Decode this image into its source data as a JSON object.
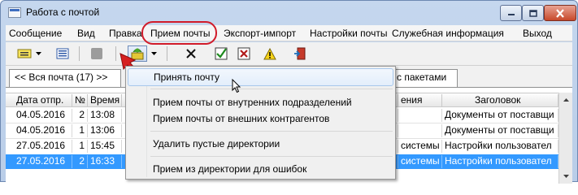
{
  "window": {
    "title": "Работа с почтой"
  },
  "menu": {
    "items": [
      {
        "label": "Сообщение"
      },
      {
        "label": "Вид"
      },
      {
        "label": "Правка"
      },
      {
        "label": "Прием почты"
      },
      {
        "label": "Экспорт-импорт"
      },
      {
        "label": "Настройки почты"
      },
      {
        "label": "Служебная информация"
      },
      {
        "label": "Выход"
      }
    ]
  },
  "toolbar": {
    "icons": [
      "envelope-list-icon",
      "list-view-icon",
      "stop-icon",
      "receive-mail-icon",
      "delete-icon",
      "confirm-icon",
      "reject-icon",
      "warning-icon",
      "exit-icon"
    ]
  },
  "tabs": {
    "items": [
      {
        "label": "<< Вся почта (17) >>"
      },
      {
        "label": "с пакетами"
      }
    ]
  },
  "table": {
    "columns": [
      "Дата отпр.",
      "№",
      "Время",
      "",
      "ения",
      "Заголовок"
    ],
    "rows": [
      {
        "date": "04.05.2016",
        "num": "2",
        "time": "13:08",
        "col4": "",
        "col5": "",
        "title": "Документы от поставщи"
      },
      {
        "date": "04.05.2016",
        "num": "1",
        "time": "13:06",
        "col4": "",
        "col5": "",
        "title": "Документы от поставщи"
      },
      {
        "date": "27.05.2016",
        "num": "1",
        "time": "15:45",
        "col4": "",
        "col5": "системы",
        "title": "Настройки пользовател"
      },
      {
        "date": "27.05.2016",
        "num": "2",
        "time": "16:33",
        "col4": "",
        "col5": "системы",
        "title": "Настройки пользовател"
      }
    ]
  },
  "dropdown": {
    "items": [
      {
        "label": "Принять почту"
      },
      {
        "label": "Прием почты от внутренних подразделений"
      },
      {
        "label": "Прием почты от внешних контрагентов"
      },
      {
        "label": "Удалить пустые директории"
      },
      {
        "label": "Прием из директории для ошибок"
      }
    ]
  },
  "colors": {
    "highlight_ring": "#d11b2a",
    "selection": "#3399ff"
  }
}
